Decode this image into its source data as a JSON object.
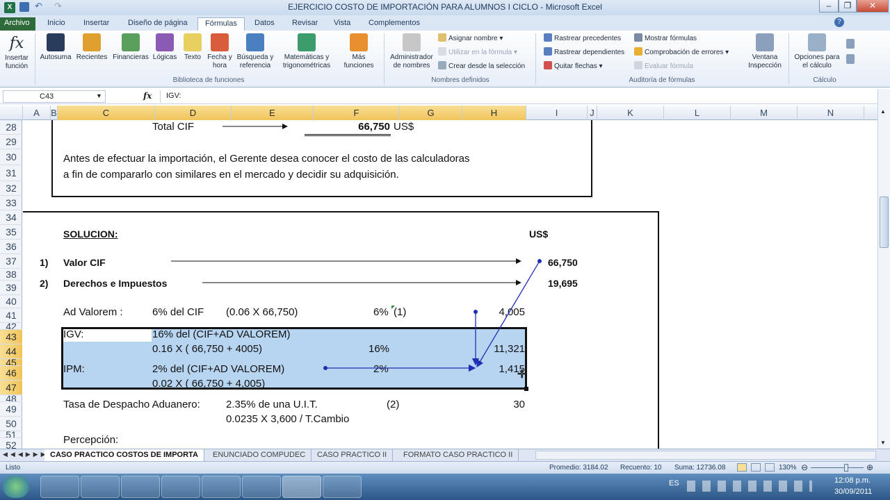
{
  "window": {
    "title": "EJERCICIO COSTO DE IMPORTACIÓN PARA ALUMNOS I CICLO - Microsoft Excel"
  },
  "tabs": [
    "Archivo",
    "Inicio",
    "Insertar",
    "Diseño de página",
    "Fórmulas",
    "Datos",
    "Revisar",
    "Vista",
    "Complementos"
  ],
  "active_tab": "Fórmulas",
  "ribbon": {
    "insertar_funcion": "Insertar función",
    "library": [
      {
        "label": "Autosuma",
        "color": "#2a3c5c"
      },
      {
        "label": "Recientes",
        "color": "#e0a030"
      },
      {
        "label": "Financieras",
        "color": "#5aa05a"
      },
      {
        "label": "Lógicas",
        "color": "#8a5ab5"
      },
      {
        "label": "Texto",
        "color": "#e8d060"
      },
      {
        "label": "Fecha y hora",
        "color": "#d95c3c"
      },
      {
        "label": "Búsqueda y referencia",
        "color": "#4a7fc0"
      },
      {
        "label": "Matemáticas y trigonométricas",
        "color": "#3c9c6c"
      },
      {
        "label": "Más funciones",
        "color": "#e89030"
      }
    ],
    "library_group": "Biblioteca de funciones",
    "name_manager": "Administrador de nombres",
    "names_small": [
      "Asignar nombre",
      "Utilizar en la fórmula",
      "Crear desde la selección"
    ],
    "names_group": "Nombres definidos",
    "audit_left": [
      "Rastrear precedentes",
      "Rastrear dependientes",
      "Quitar flechas"
    ],
    "audit_right": [
      "Mostrar fórmulas",
      "Comprobación de errores",
      "Evaluar fórmula"
    ],
    "watch": "Ventana Inspección",
    "audit_group": "Auditoría de fórmulas",
    "calc_options": "Opciones para el cálculo",
    "calc_group": "Cálculo"
  },
  "formula_bar": {
    "name_box": "C43",
    "fx": "fx",
    "content": "IGV:"
  },
  "columns": [
    "A",
    "B",
    "C",
    "D",
    "E",
    "F",
    "G",
    "H",
    "I",
    "J",
    "K",
    "L",
    "M",
    "N"
  ],
  "rows": [
    "28",
    "29",
    "30",
    "31",
    "32",
    "33",
    "34",
    "35",
    "36",
    "37",
    "38",
    "39",
    "40",
    "41",
    "42",
    "43",
    "44",
    "45",
    "46",
    "47",
    "48",
    "49",
    "50",
    "51",
    "52"
  ],
  "cells": {
    "total_cif_label": "Total CIF",
    "total_cif_value": "66,750",
    "total_cif_unit": "US$",
    "intro_line1": "Antes de efectuar la importación, el Gerente desea conocer el costo de las calculadoras",
    "intro_line2": "a fin de compararlo con similares en el mercado y decidir su adquisición.",
    "solucion": "SOLUCION:",
    "us_header": "US$",
    "item1_num": "1)",
    "item1_label": "Valor CIF",
    "item1_value": "66,750",
    "item2_num": "2)",
    "item2_label": "Derechos e Impuestos",
    "item2_value": "19,695",
    "adval_label": "Ad Valorem :",
    "adval_desc": "6% del CIF",
    "adval_calc": "(0.06 X 66,750)",
    "adval_pct": "6%",
    "adval_ref": "(1)",
    "adval_value": "4,005",
    "igv_label": "IGV:",
    "igv_desc": "16% del (CIF+AD VALOREM)",
    "igv_calc": "0.16 X ( 66,750 + 4005)",
    "igv_pct": "16%",
    "igv_value": "11,321",
    "ipm_label": "IPM:",
    "ipm_desc": "2% del (CIF+AD VALOREM)",
    "ipm_calc": "0.02 X ( 66,750 + 4,005)",
    "ipm_pct": "2%",
    "ipm_value": "1,415",
    "tasa_label": "Tasa de Despacho Aduanero:",
    "tasa_desc": "2.35% de una U.I.T.",
    "tasa_ref": "(2)",
    "tasa_value": "30",
    "tasa_calc": "0.0235 X 3,600 / T.Cambio",
    "percepcion": "Percepción:"
  },
  "sheet_tabs": [
    "CASO PRACTICO COSTOS DE IMPORTA",
    "ENUNCIADO COMPUDEC",
    "CASO PRACTICO II",
    "FORMATO CASO PRACTICO II"
  ],
  "status": {
    "ready": "Listo",
    "average": "Promedio: 3184.02",
    "count": "Recuento: 10",
    "sum": "Suma: 12736.08",
    "zoom": "130%"
  },
  "taskbar": {
    "lang": "ES",
    "time": "12:08 p.m.",
    "date": "30/09/2011"
  },
  "colors": {
    "accent": "#2f6a3a",
    "selection": "#b7d4f1",
    "arrow": "#1f2fb5"
  }
}
